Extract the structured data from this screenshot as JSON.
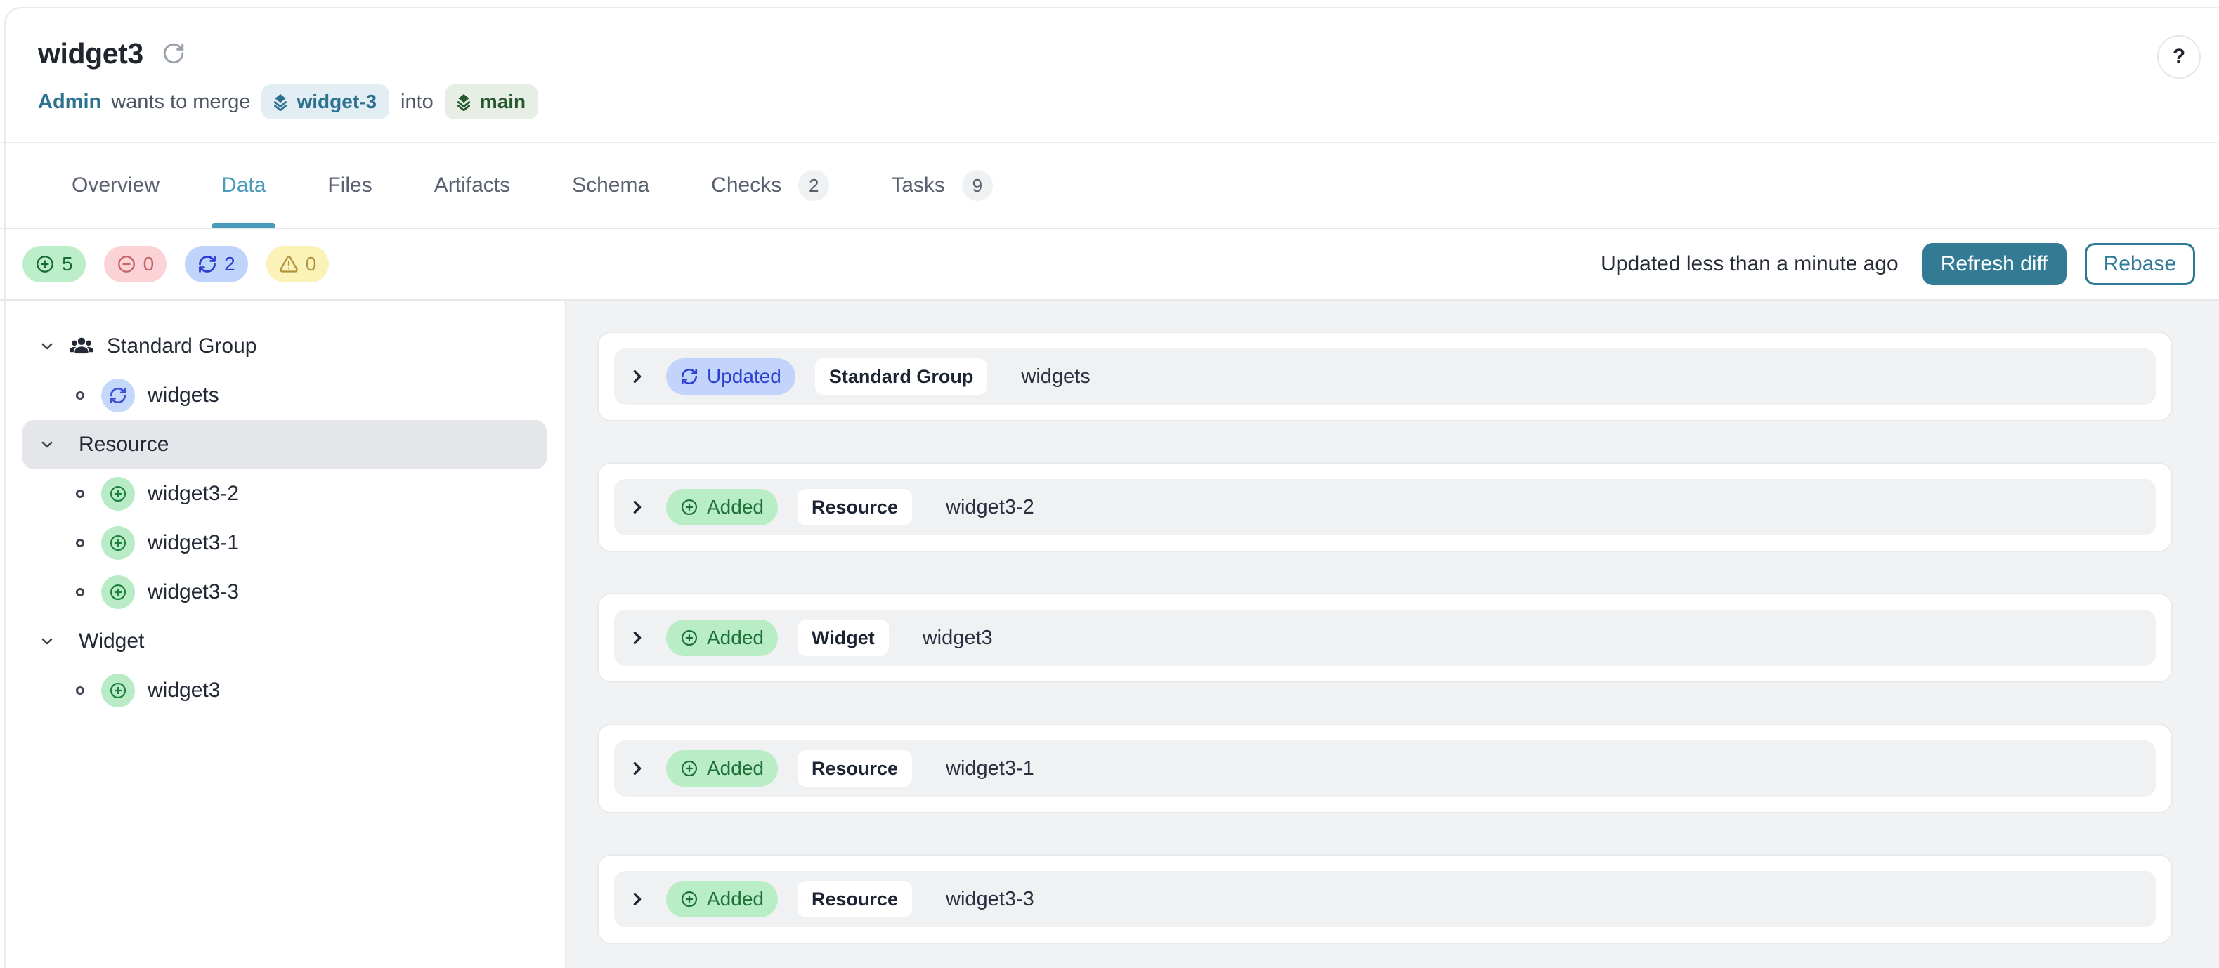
{
  "header": {
    "title": "widget3",
    "author": "Admin",
    "merge_text_1": "wants to merge",
    "source_branch": "widget-3",
    "merge_text_2": "into",
    "target_branch": "main",
    "help_label": "?"
  },
  "tabs": [
    {
      "label": "Overview",
      "active": false
    },
    {
      "label": "Data",
      "active": true
    },
    {
      "label": "Files",
      "active": false
    },
    {
      "label": "Artifacts",
      "active": false
    },
    {
      "label": "Schema",
      "active": false
    },
    {
      "label": "Checks",
      "active": false,
      "count": "2"
    },
    {
      "label": "Tasks",
      "active": false,
      "count": "9"
    }
  ],
  "diff_summary": {
    "added": "5",
    "removed": "0",
    "updated": "2",
    "warnings": "0",
    "updated_text": "Updated less than a minute ago",
    "refresh_button": "Refresh diff",
    "rebase_button": "Rebase"
  },
  "sidebar": {
    "groups": [
      {
        "label": "Standard Group",
        "icon": "users",
        "selected": false,
        "children": [
          {
            "name": "widgets",
            "change": "updated"
          }
        ]
      },
      {
        "label": "Resource",
        "selected": true,
        "children": [
          {
            "name": "widget3-2",
            "change": "added"
          },
          {
            "name": "widget3-1",
            "change": "added"
          },
          {
            "name": "widget3-3",
            "change": "added"
          }
        ]
      },
      {
        "label": "Widget",
        "selected": false,
        "children": [
          {
            "name": "widget3",
            "change": "added"
          }
        ]
      }
    ]
  },
  "diff_rows": [
    {
      "change": "Updated",
      "type": "Standard Group",
      "name": "widgets"
    },
    {
      "change": "Added",
      "type": "Resource",
      "name": "widget3-2"
    },
    {
      "change": "Added",
      "type": "Widget",
      "name": "widget3"
    },
    {
      "change": "Added",
      "type": "Resource",
      "name": "widget3-1"
    },
    {
      "change": "Added",
      "type": "Resource",
      "name": "widget3-3"
    }
  ],
  "colors": {
    "accent_teal": "#337a94",
    "active_tab_teal": "#4a9ab9",
    "link_teal": "#2d7190",
    "updated_badge_bg": "#c2d4fb",
    "updated_badge_text": "#2c3fd1",
    "added_badge_bg": "#b9edc6",
    "added_badge_text": "#1e7038",
    "removed_pill_bg": "#fbd2d6",
    "warning_pill_bg": "#fbf2b8",
    "source_branch_bg": "#e3edf4",
    "target_branch_bg": "#e6eee5",
    "main_area_bg": "#f1f2f4",
    "selected_row_bg": "#e4e6ea"
  }
}
